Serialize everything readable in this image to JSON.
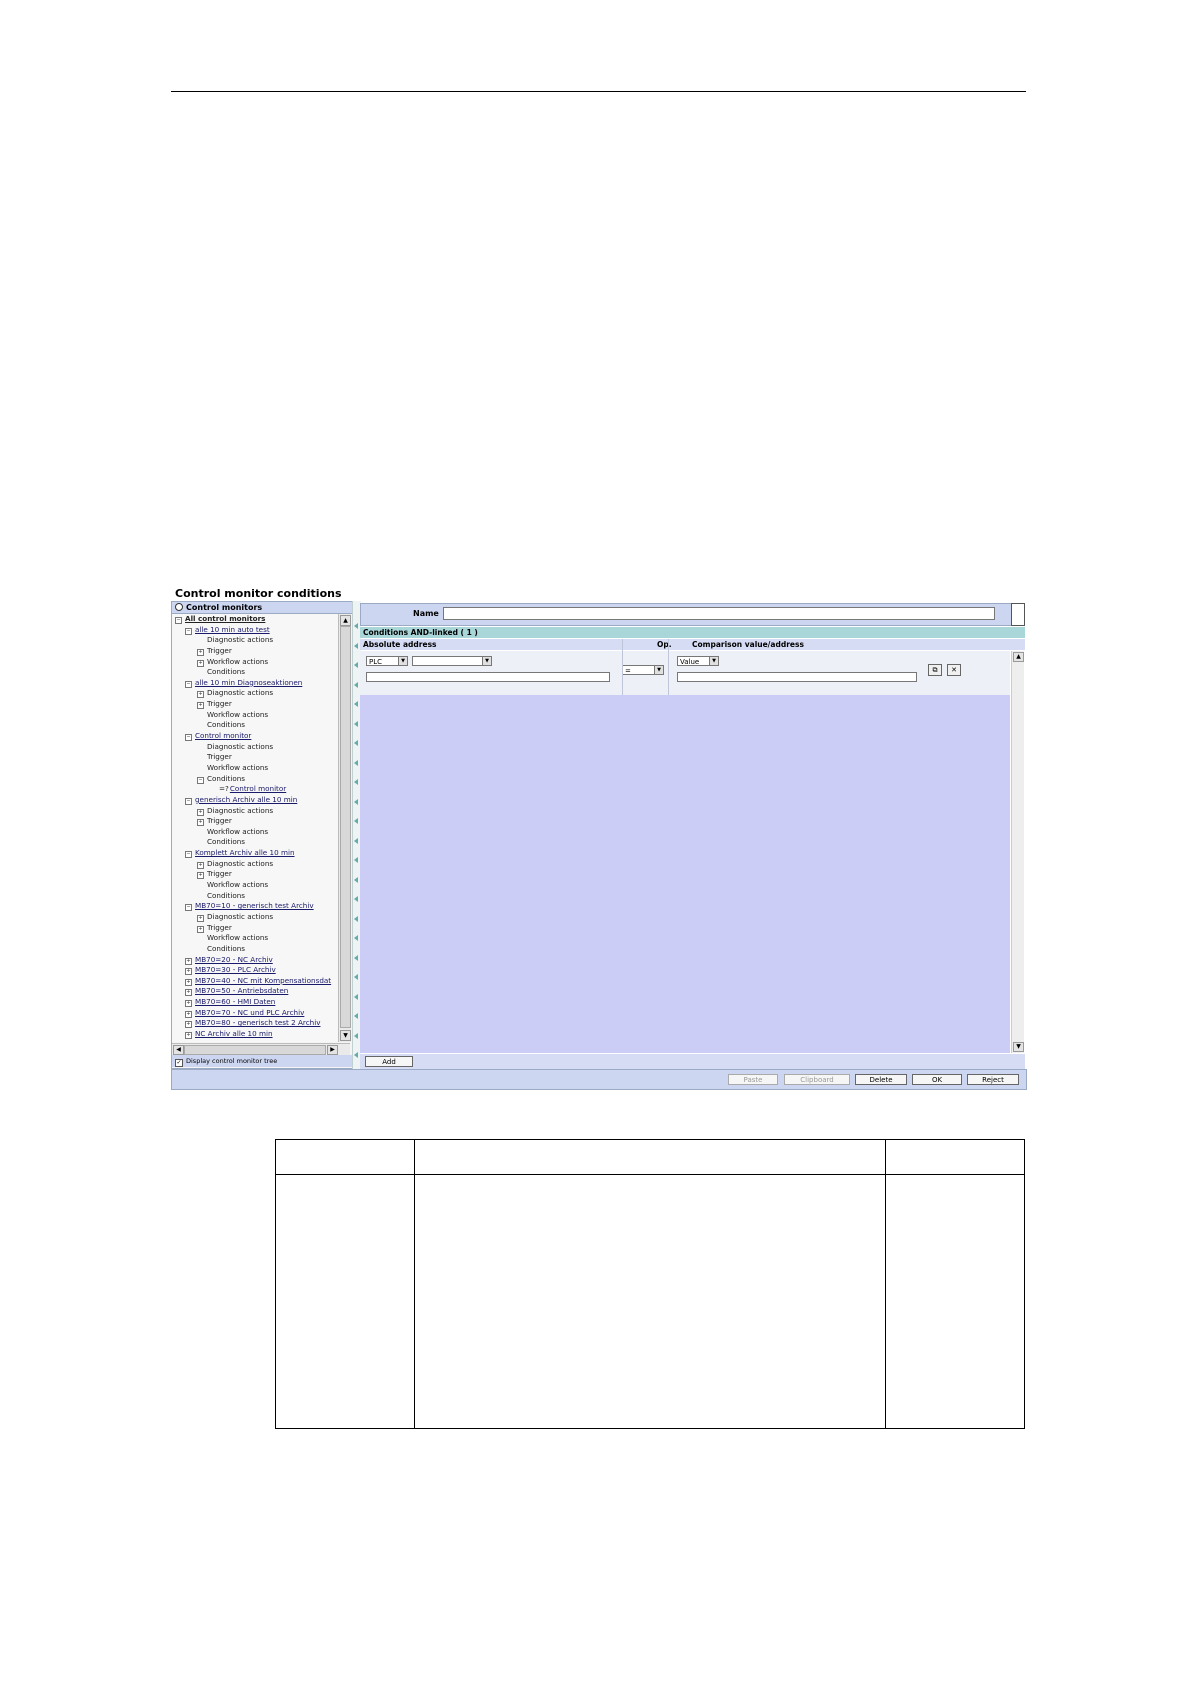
{
  "figure_title": "Control monitor conditions",
  "left_panel": {
    "header": "Control monitors",
    "tree": [
      {
        "label": "All control monitors",
        "level": 0,
        "toggle": "−",
        "style": "bold"
      },
      {
        "label": "alle 10 min auto test",
        "level": 1,
        "toggle": "−",
        "style": "link"
      },
      {
        "label": "Diagnostic actions",
        "level": 2,
        "toggle": "",
        "style": "plain"
      },
      {
        "label": "Trigger",
        "level": 2,
        "toggle": "+",
        "style": "plain"
      },
      {
        "label": "Workflow actions",
        "level": 2,
        "toggle": "+",
        "style": "plain"
      },
      {
        "label": "Conditions",
        "level": 2,
        "toggle": "",
        "style": "plain"
      },
      {
        "label": "alle 10 min Diagnoseaktionen",
        "level": 1,
        "toggle": "−",
        "style": "link"
      },
      {
        "label": "Diagnostic actions",
        "level": 2,
        "toggle": "+",
        "style": "plain"
      },
      {
        "label": "Trigger",
        "level": 2,
        "toggle": "+",
        "style": "plain"
      },
      {
        "label": "Workflow actions",
        "level": 2,
        "toggle": "",
        "style": "plain"
      },
      {
        "label": "Conditions",
        "level": 2,
        "toggle": "",
        "style": "plain"
      },
      {
        "label": "Control monitor",
        "level": 1,
        "toggle": "−",
        "style": "link"
      },
      {
        "label": "Diagnostic actions",
        "level": 2,
        "toggle": "",
        "style": "plain"
      },
      {
        "label": "Trigger",
        "level": 2,
        "toggle": "",
        "style": "plain"
      },
      {
        "label": "Workflow actions",
        "level": 2,
        "toggle": "",
        "style": "plain"
      },
      {
        "label": "Conditions",
        "level": 2,
        "toggle": "−",
        "style": "plain"
      },
      {
        "label": "Control monitor",
        "level": 3,
        "toggle": "",
        "style": "link",
        "prefix": "=?"
      },
      {
        "label": "generisch Archiv alle 10 min",
        "level": 1,
        "toggle": "−",
        "style": "link"
      },
      {
        "label": "Diagnostic actions",
        "level": 2,
        "toggle": "+",
        "style": "plain"
      },
      {
        "label": "Trigger",
        "level": 2,
        "toggle": "+",
        "style": "plain"
      },
      {
        "label": "Workflow actions",
        "level": 2,
        "toggle": "",
        "style": "plain"
      },
      {
        "label": "Conditions",
        "level": 2,
        "toggle": "",
        "style": "plain"
      },
      {
        "label": "Komplett Archiv alle 10 min",
        "level": 1,
        "toggle": "−",
        "style": "link"
      },
      {
        "label": "Diagnostic actions",
        "level": 2,
        "toggle": "+",
        "style": "plain"
      },
      {
        "label": "Trigger",
        "level": 2,
        "toggle": "+",
        "style": "plain"
      },
      {
        "label": "Workflow actions",
        "level": 2,
        "toggle": "",
        "style": "plain"
      },
      {
        "label": "Conditions",
        "level": 2,
        "toggle": "",
        "style": "plain"
      },
      {
        "label": "MB70=10 - generisch test Archiv",
        "level": 1,
        "toggle": "−",
        "style": "link"
      },
      {
        "label": "Diagnostic actions",
        "level": 2,
        "toggle": "+",
        "style": "plain"
      },
      {
        "label": "Trigger",
        "level": 2,
        "toggle": "+",
        "style": "plain"
      },
      {
        "label": "Workflow actions",
        "level": 2,
        "toggle": "",
        "style": "plain"
      },
      {
        "label": "Conditions",
        "level": 2,
        "toggle": "",
        "style": "plain"
      },
      {
        "label": "MB70=20 - NC Archiv",
        "level": 1,
        "toggle": "+",
        "style": "link"
      },
      {
        "label": "MB70=30 - PLC Archiv",
        "level": 1,
        "toggle": "+",
        "style": "link"
      },
      {
        "label": "MB70=40 - NC mit Kompensationsdat",
        "level": 1,
        "toggle": "+",
        "style": "link"
      },
      {
        "label": "MB70=50 - Antriebsdaten",
        "level": 1,
        "toggle": "+",
        "style": "link"
      },
      {
        "label": "MB70=60 - HMI Daten",
        "level": 1,
        "toggle": "+",
        "style": "link"
      },
      {
        "label": "MB70=70 - NC und PLC Archiv",
        "level": 1,
        "toggle": "+",
        "style": "link"
      },
      {
        "label": "MB70=80 - generisch test 2 Archiv",
        "level": 1,
        "toggle": "+",
        "style": "link"
      },
      {
        "label": "NC Archiv alle 10 min",
        "level": 1,
        "toggle": "+",
        "style": "link"
      }
    ],
    "footer_checkbox_label": "Display control monitor tree",
    "footer_checked": true
  },
  "right_panel": {
    "name_label": "Name",
    "name_value": "",
    "conditions_header": "Conditions AND-linked ( 1 )",
    "columns": {
      "absolute_address": "Absolute address",
      "op": "Op.",
      "comparison": "Comparison value/address"
    },
    "row": {
      "address_type": "PLC",
      "address_sub": "",
      "operator": "=",
      "comparison_type": "Value",
      "address_text": "",
      "comparison_text": ""
    },
    "add_button": "Add"
  },
  "bottom_buttons": {
    "paste": "Paste",
    "clipboard": "Clipboard",
    "delete": "Delete",
    "ok": "OK",
    "reject": "Reject"
  }
}
